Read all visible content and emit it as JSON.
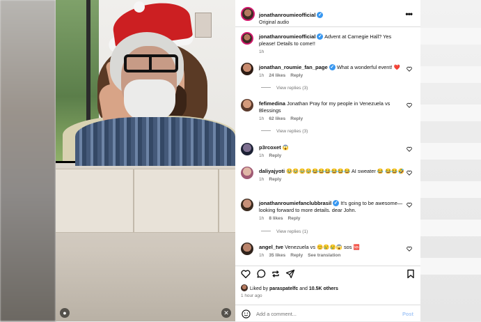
{
  "post": {
    "username": "jonathanroumieofficial",
    "audio": "Original audio",
    "caption": "Advent at Carnegie Hall? Yes please! Details to come!!",
    "caption_time": "1h"
  },
  "comments": [
    {
      "user": "jonathan_roumie_fan_page",
      "verified": true,
      "text": "What a wonderful event! ❤️",
      "time": "1h",
      "likes": "24 likes",
      "reply": "Reply",
      "view_replies": "View replies (3)"
    },
    {
      "user": "fefimedina",
      "verified": false,
      "text": "Jonathan Pray for my people in Venezuela vs Blessings",
      "time": "1h",
      "likes": "62 likes",
      "reply": "Reply",
      "view_replies": "View replies (3)"
    },
    {
      "user": "p3rcoxet",
      "verified": false,
      "text": "😱",
      "time": "1h",
      "likes": "",
      "reply": "Reply",
      "view_replies": ""
    },
    {
      "user": "daliyajyoti",
      "verified": false,
      "text": "🥹🥹🥹🥹😂😂😂😂😂😂 AI sweater 😂 😂😂🤣",
      "time": "1h",
      "likes": "",
      "reply": "Reply",
      "view_replies": ""
    },
    {
      "user": "jonathanroumiefanclubbrasil",
      "verified": true,
      "text": "It's going to be awesome— looking forward to more details. dear John.",
      "time": "1h",
      "likes": "8 likes",
      "reply": "Reply",
      "view_replies": "View replies (1)"
    },
    {
      "user": "angel_tve",
      "verified": false,
      "text": "Venezuela vs 😊😢😢😱 sos 🆘",
      "time": "1h",
      "likes": "35 likes",
      "reply": "Reply",
      "translation": "See translation",
      "view_replies": ""
    }
  ],
  "footer": {
    "liked_prefix": "Liked by",
    "liked_user": "paraspatelfc",
    "liked_and": "and",
    "liked_count": "10.5K others",
    "time": "1 hour ago",
    "add_comment_placeholder": "Add a comment...",
    "post_label": "Post"
  },
  "icons": [
    "heart-icon",
    "comment-icon",
    "repost-icon",
    "share-icon",
    "save-icon",
    "emoji-icon",
    "more-icon",
    "verified-icon",
    "mute-icon",
    "person-icon"
  ],
  "colors": {
    "verified": "#3897f0",
    "post_disabled": "#a6c8f7",
    "ring": "#d1186d"
  }
}
